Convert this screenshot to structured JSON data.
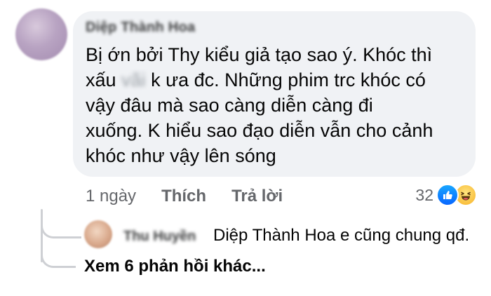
{
  "comment": {
    "author": "Diệp Thành Hoa",
    "text_before": "Bị ớn bởi Thy kiểu giả tạo sao ý. Khóc thì\nxấu ",
    "censored_word": "vãi",
    "text_after": " k ưa đc. Những phim trc khóc có\nvậy đâu mà sao càng diễn càng đi\nxuống. K hiểu sao đạo diễn vẫn cho cảnh\nkhóc như vậy lên sóng",
    "time": "1 ngày",
    "like_label": "Thích",
    "reply_label": "Trả lời",
    "reaction_count": "32",
    "reaction_icons": [
      "like-icon",
      "haha-icon"
    ]
  },
  "reply": {
    "author": "Thu Huyền",
    "text": "Diệp Thành Hoa e cũng chung qđ."
  },
  "more_replies_label": "Xem 6 phản hồi khác...",
  "colors": {
    "bubble": "#f0f2f5",
    "secondary_text": "#65676b",
    "like_blue": "#0866ff",
    "thread_line": "#ced0d4"
  }
}
